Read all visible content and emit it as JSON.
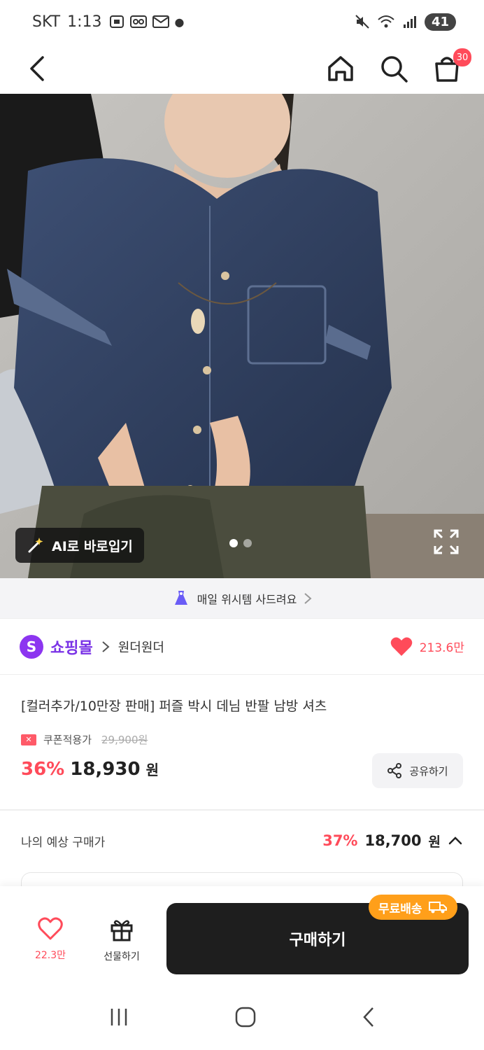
{
  "status_bar": {
    "carrier": "SKT",
    "time": "1:13",
    "battery": "41"
  },
  "header": {
    "cart_count": "30"
  },
  "product_image": {
    "ai_button_label": "AI로 바로입기",
    "slide_count": 2,
    "active_slide": 1
  },
  "wish_banner": {
    "text": "매일 위시템 사드려요"
  },
  "shop": {
    "logo_letter": "S",
    "name": "쇼핑몰",
    "seller": "원더원더",
    "like_count": "213.6만"
  },
  "product": {
    "title": "[컬러추가/10만장 판매] 퍼즐 박시 데님 반팔 남방 셔츠",
    "coupon_label": "쿠폰적용가",
    "original_price": "29,900원",
    "discount": "36%",
    "price": "18,930",
    "currency": "원",
    "share_label": "공유하기"
  },
  "expected": {
    "label": "나의 예상 구매가",
    "discount": "37%",
    "price": "18,700",
    "currency": "원"
  },
  "bottom_bar": {
    "like_count": "22.3만",
    "gift_label": "선물하기",
    "buy_label": "구매하기",
    "free_shipping_label": "무료배송"
  },
  "colors": {
    "accent": "#ff4b5a",
    "shop_purple": "#8c35f0",
    "buy_button": "#1e1e1e",
    "free_ship": "#ff9f1a"
  }
}
